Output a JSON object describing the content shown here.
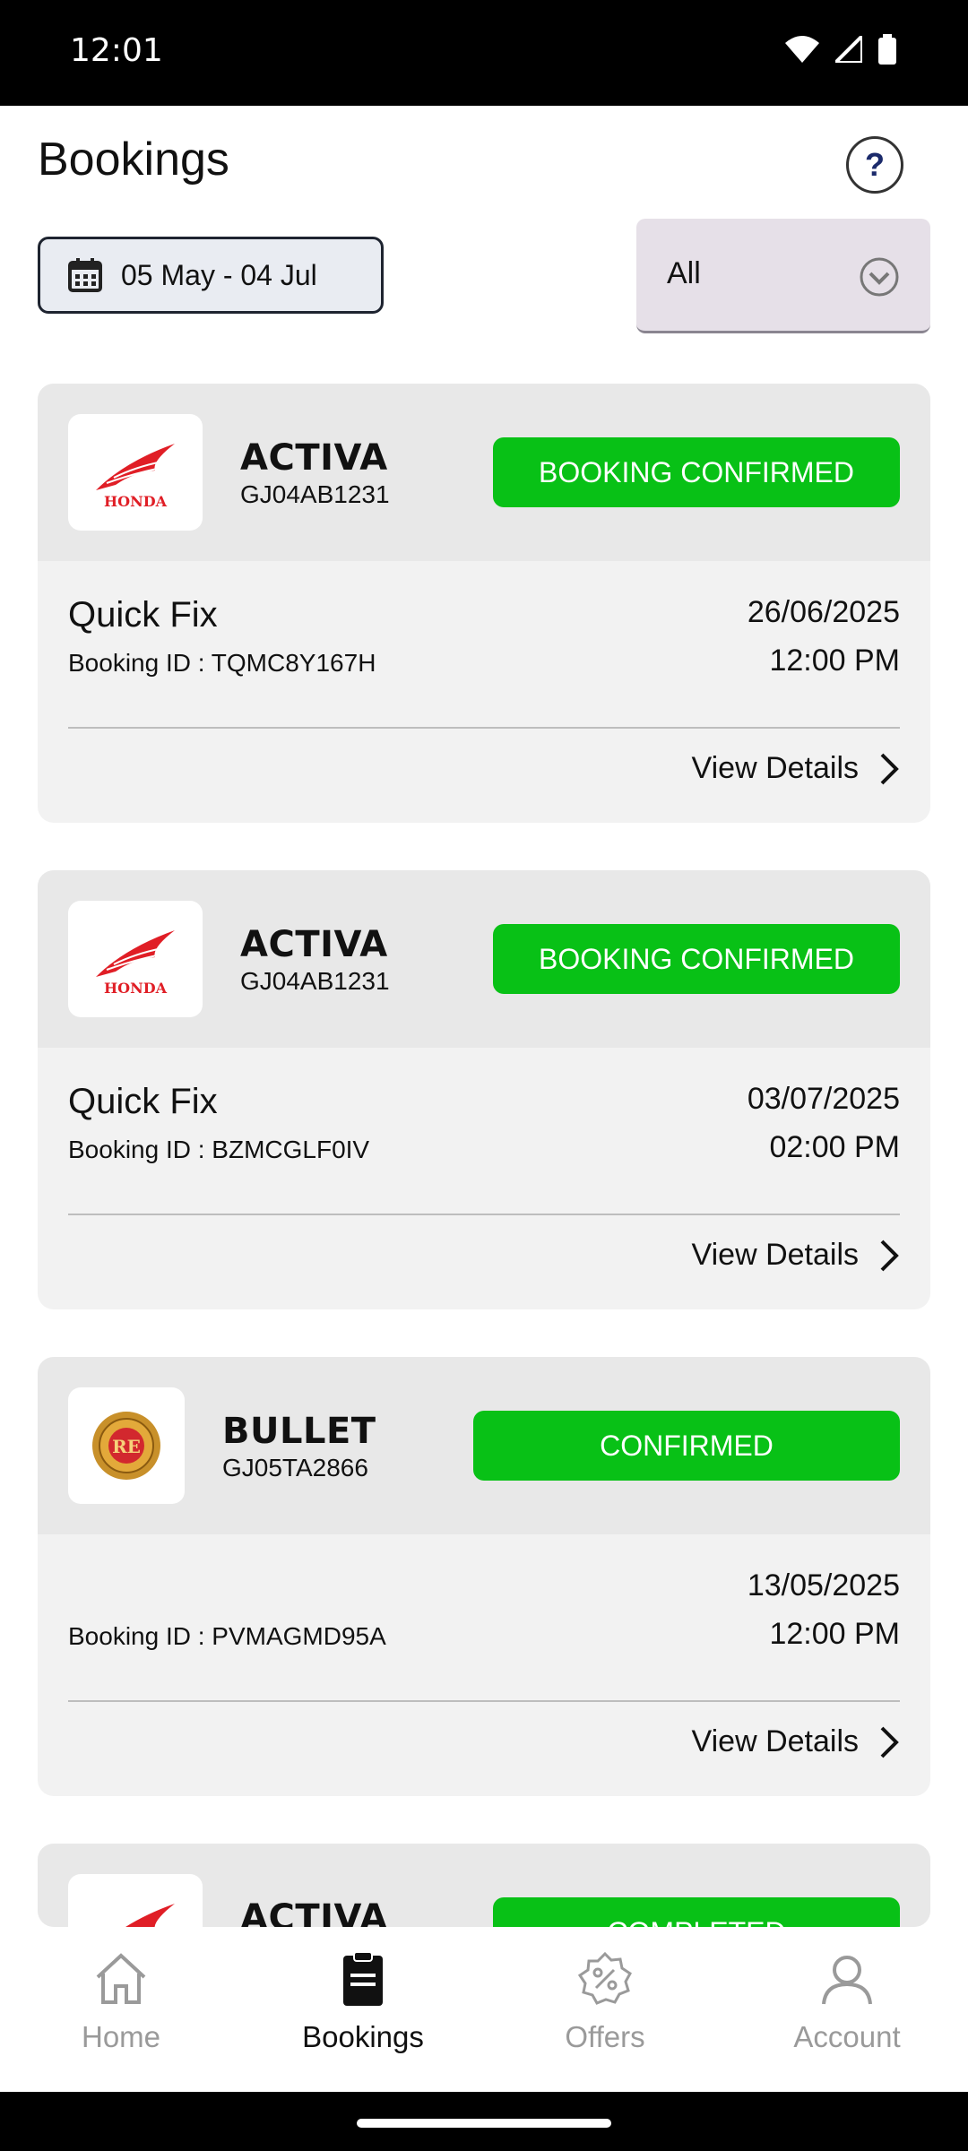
{
  "status_bar": {
    "time": "12:01"
  },
  "header": {
    "title": "Bookings",
    "help_symbol": "?"
  },
  "filters": {
    "date_range": "05 May - 04 Jul",
    "status_filter": "All"
  },
  "bookings": [
    {
      "model": "ACTIVA",
      "plate": "GJ04AB1231",
      "status": "BOOKING CONFIRMED",
      "service": "Quick Fix",
      "booking_id": "Booking ID : TQMC8Y167H",
      "date": "26/06/2025",
      "time": "12:00 PM",
      "details_label": "View Details",
      "brand_text": "HONDA"
    },
    {
      "model": "ACTIVA",
      "plate": "GJ04AB1231",
      "status": "BOOKING CONFIRMED",
      "service": "Quick Fix",
      "booking_id": "Booking ID : BZMCGLF0IV",
      "date": "03/07/2025",
      "time": "02:00 PM",
      "details_label": "View Details",
      "brand_text": "HONDA"
    },
    {
      "model": "BULLET",
      "plate": "GJ05TA2866",
      "status": "CONFIRMED",
      "service": "",
      "booking_id": "Booking ID : PVMAGMD95A",
      "date": "13/05/2025",
      "time": "12:00 PM",
      "details_label": "View Details",
      "brand_text": "RE"
    },
    {
      "model": "ACTIVA",
      "status": "COMPLETED"
    }
  ],
  "colors": {
    "status_green": "#08c116",
    "honda_red": "#e01e26"
  },
  "bottom_nav": [
    {
      "label": "Home",
      "icon": "home-icon",
      "active": false
    },
    {
      "label": "Bookings",
      "icon": "clipboard-icon",
      "active": true
    },
    {
      "label": "Offers",
      "icon": "offer-badge-icon",
      "active": false
    },
    {
      "label": "Account",
      "icon": "account-icon",
      "active": false
    }
  ]
}
